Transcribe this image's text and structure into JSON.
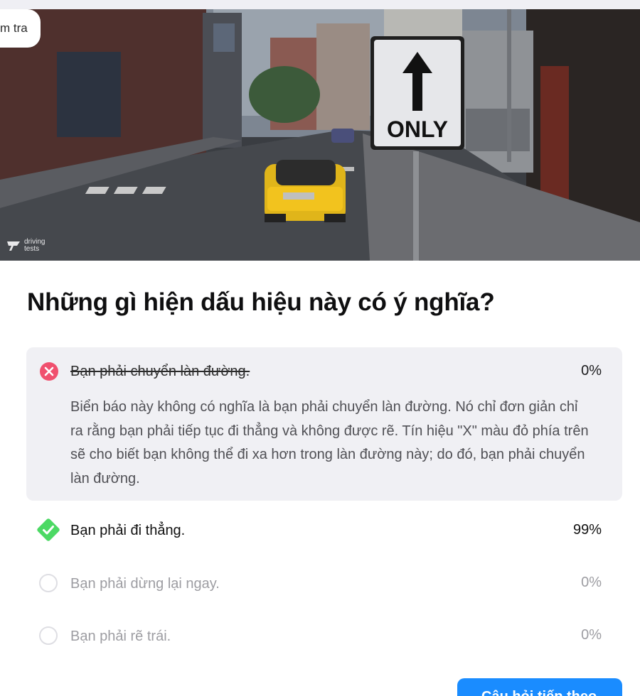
{
  "header": {
    "tab_label": "m tra"
  },
  "scene": {
    "sign_text": "ONLY",
    "watermark": "driving tests",
    "watermark_line1": "driving",
    "watermark_line2": "tests"
  },
  "question": "Những gì hiện dấu hiệu này có ý nghĩa?",
  "options": [
    {
      "label": "Bạn phải chuyển làn đường.",
      "percent": "0%",
      "state": "wrong",
      "explanation": "Biển báo này không có nghĩa là bạn phải chuyển làn đường. Nó chỉ đơn giản chỉ ra rằng bạn phải tiếp tục đi thẳng và không được rẽ. Tín hiệu \"X\" màu đỏ phía trên sẽ cho biết bạn không thể đi xa hơn trong làn đường này; do đó, bạn phải chuyển làn đường."
    },
    {
      "label": "Bạn phải đi thẳng.",
      "percent": "99%",
      "state": "correct"
    },
    {
      "label": "Bạn phải dừng lại ngay.",
      "percent": "0%",
      "state": "unselected"
    },
    {
      "label": "Bạn phải rẽ trái.",
      "percent": "0%",
      "state": "unselected"
    }
  ],
  "next_button": "Câu hỏi tiếp theo",
  "colors": {
    "wrong": "#f0506e",
    "correct": "#4cd964",
    "accent": "#1a8cff",
    "panel": "#f0f0f4"
  }
}
